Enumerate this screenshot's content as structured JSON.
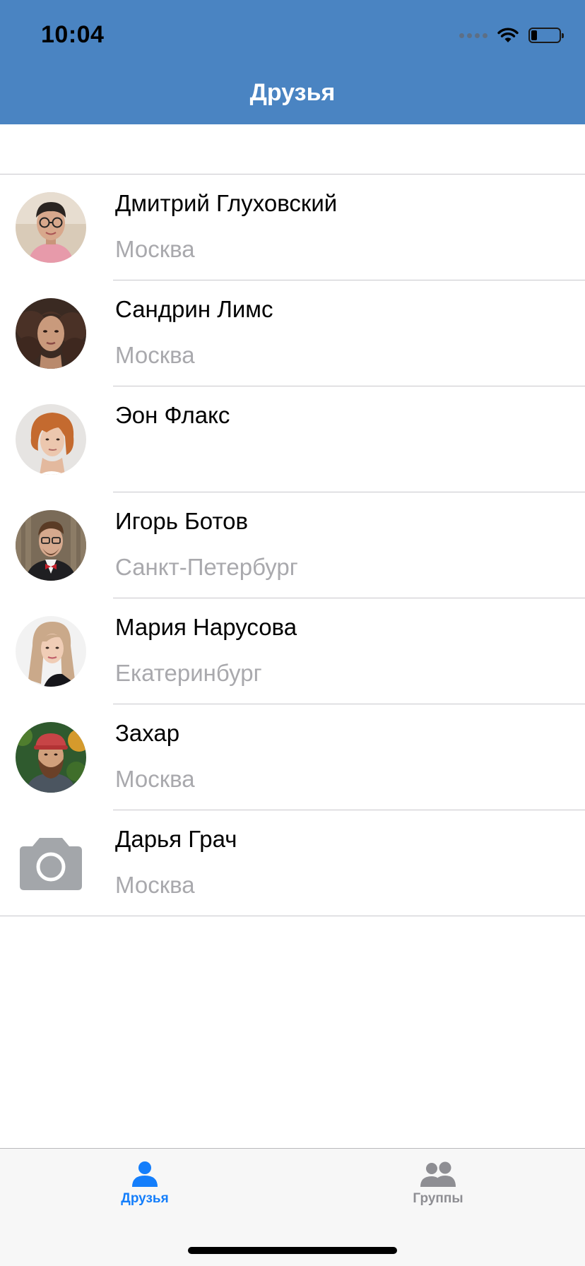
{
  "status_bar": {
    "time": "10:04",
    "battery_level": 0.2
  },
  "nav": {
    "title": "Друзья"
  },
  "friends": [
    {
      "name": "Дмитрий Глуховский",
      "city": "Москва",
      "avatar": "photo-man-glasses"
    },
    {
      "name": "Сандрин Лимс",
      "city": "Москва",
      "avatar": "photo-woman-curly"
    },
    {
      "name": "Эон Флакс",
      "city": "",
      "avatar": "photo-woman-red-hair"
    },
    {
      "name": "Игорь Ботов",
      "city": "Санкт-Петербург",
      "avatar": "photo-man-bowtie"
    },
    {
      "name": "Мария Нарусова",
      "city": "Екатеринбург",
      "avatar": "photo-woman-blonde"
    },
    {
      "name": "Захар",
      "city": "Москва",
      "avatar": "photo-man-cap-beard"
    },
    {
      "name": "Дарья Грач",
      "city": "Москва",
      "avatar": "camera-placeholder-icon"
    }
  ],
  "tabbar": {
    "friends_label": "Друзья",
    "groups_label": "Группы",
    "active_color": "#147EFB",
    "inactive_color": "#8E8E93"
  },
  "colors": {
    "header": "#4A84C2",
    "secondary_text": "#A9A9AD"
  }
}
